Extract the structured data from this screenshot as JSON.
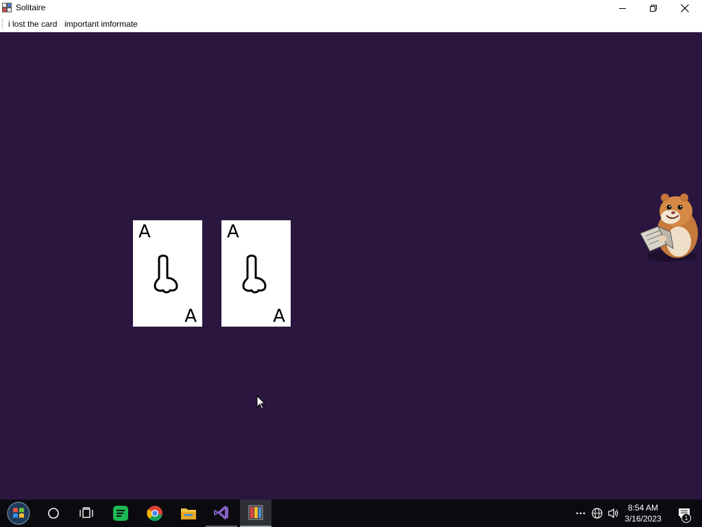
{
  "window": {
    "title": "Solitaire",
    "icon": "solitaire-app-icon"
  },
  "menu": {
    "items": [
      {
        "label": "i lost the card"
      },
      {
        "label": "important imformate"
      }
    ]
  },
  "game": {
    "background": "#2b1640",
    "cards": [
      {
        "rank": "A",
        "suit_icon": "hand-drawn-suit-icon"
      },
      {
        "rank": "A",
        "suit_icon": "hand-drawn-suit-icon"
      }
    ],
    "sprite": "hamster-reading-book"
  },
  "taskbar": {
    "apps": [
      "start-icon",
      "search-circle-icon",
      "task-view-icon",
      "spotify-icon",
      "chrome-icon",
      "file-explorer-icon",
      "visual-studio-icon",
      "solitaire-taskbar-icon"
    ],
    "clock": {
      "time": "8:54 AM",
      "date": "3/16/2023"
    },
    "notification_count": "1"
  }
}
